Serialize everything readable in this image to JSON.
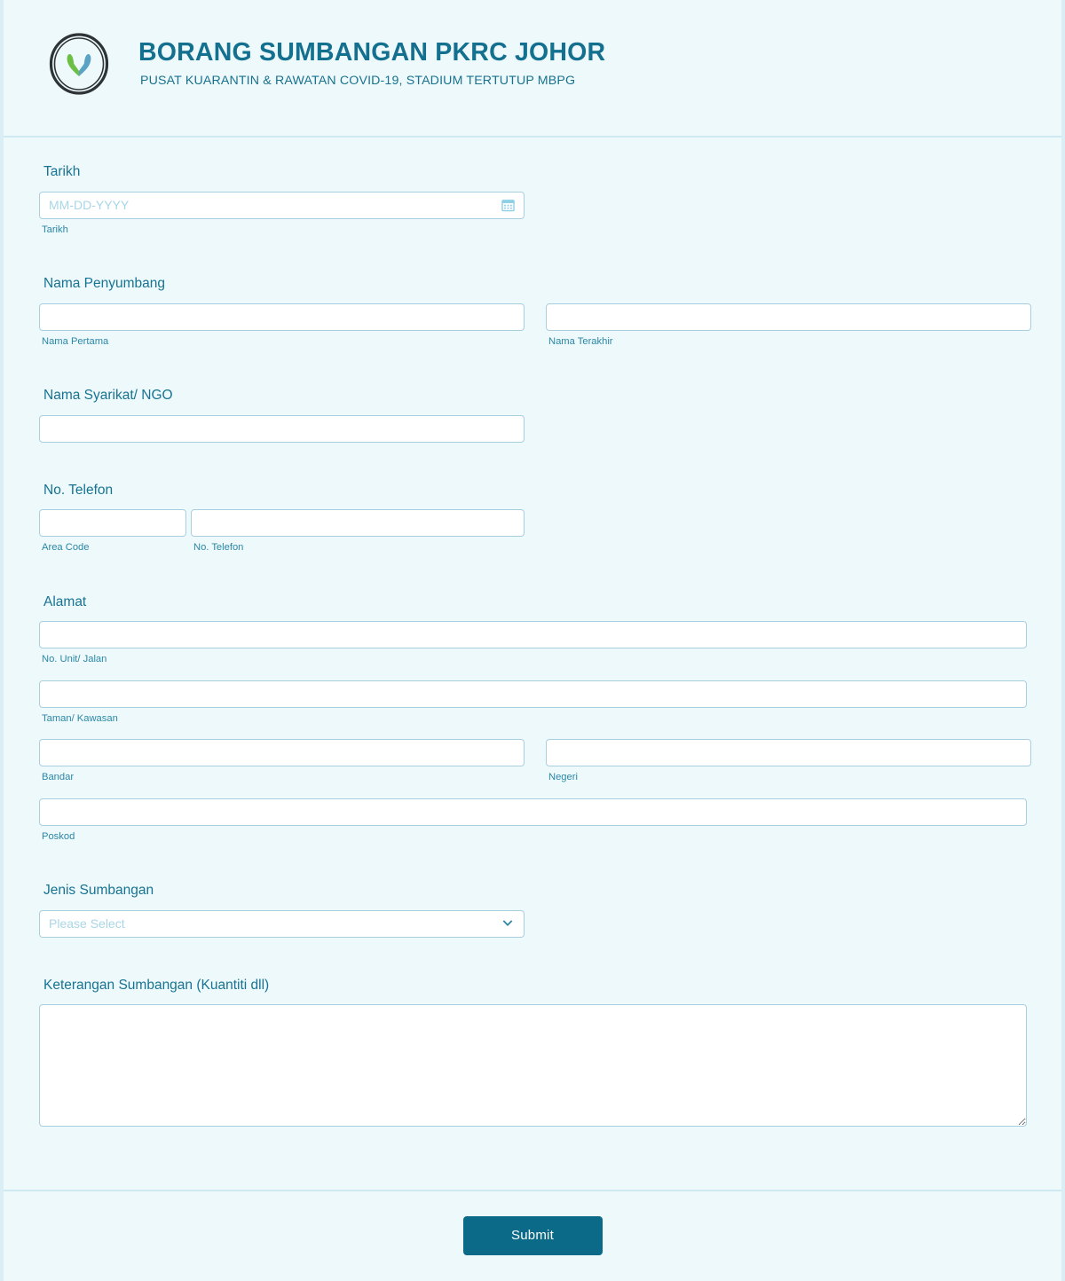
{
  "header": {
    "logo_icon": "hands-circle-logo-icon",
    "title": "BORANG SUMBANGAN PKRC JOHOR",
    "subtitle": "PUSAT KUARANTIN & RAWATAN COVID-19, STADIUM TERTUTUP MBPG"
  },
  "colors": {
    "page_background": "#eef9fc",
    "accent_teal": "#14708f",
    "label_teal": "#177392",
    "sublabel_teal": "#2b87a6",
    "input_border": "#a8cfdf",
    "placeholder": "#a9d6e6",
    "submit_background": "#0b6a87",
    "submit_text": "#ffffff",
    "divider": "#cfe9f2",
    "logo_leaf_green": "#6cbe45",
    "logo_leaf_blue": "#5ba3c4",
    "logo_ring": "#2e3436"
  },
  "fields": {
    "tarikh": {
      "label": "Tarikh",
      "placeholder": "MM-DD-YYYY",
      "value": "",
      "sub_label": "Tarikh",
      "icon": "calendar-icon"
    },
    "nama_penyumbang": {
      "label": "Nama Penyumbang",
      "first": {
        "value": "",
        "sub_label": "Nama Pertama"
      },
      "last": {
        "value": "",
        "sub_label": "Nama Terakhir"
      }
    },
    "nama_syarikat": {
      "label": "Nama Syarikat/ NGO",
      "value": ""
    },
    "no_telefon": {
      "label": "No. Telefon",
      "area_code": {
        "value": "",
        "sub_label": "Area Code"
      },
      "number": {
        "value": "",
        "sub_label": "No. Telefon"
      }
    },
    "alamat": {
      "label": "Alamat",
      "unit": {
        "value": "",
        "sub_label": "No. Unit/ Jalan"
      },
      "taman": {
        "value": "",
        "sub_label": "Taman/ Kawasan"
      },
      "bandar": {
        "value": "",
        "sub_label": "Bandar"
      },
      "negeri": {
        "value": "",
        "sub_label": "Negeri"
      },
      "poskod": {
        "value": "",
        "sub_label": "Poskod"
      }
    },
    "jenis_sumbangan": {
      "label": "Jenis Sumbangan",
      "selected": "Please Select",
      "icon": "chevron-down-icon",
      "options": [
        "Please Select"
      ]
    },
    "keterangan": {
      "label": "Keterangan Sumbangan (Kuantiti dll)",
      "value": ""
    }
  },
  "footer": {
    "submit_label": "Submit"
  }
}
